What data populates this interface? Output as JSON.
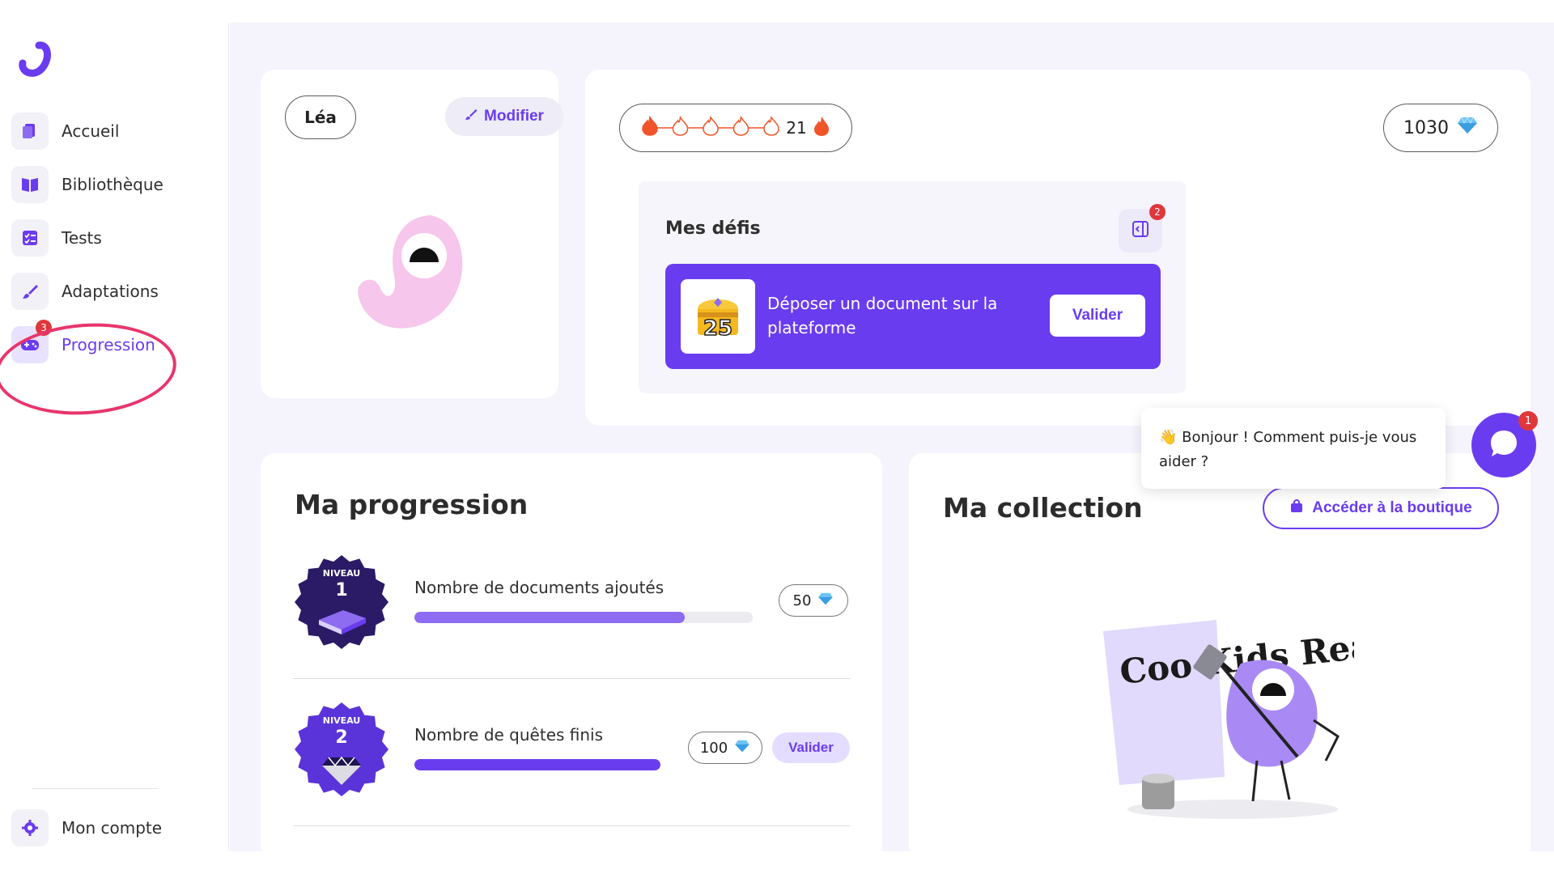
{
  "colors": {
    "accent": "#6a3cf0",
    "badge_red": "#e0373c",
    "highlight": "#e8356c",
    "background": "#f5f4fd"
  },
  "sidebar": {
    "items": [
      {
        "label": "Accueil",
        "icon": "documents-icon"
      },
      {
        "label": "Bibliothèque",
        "icon": "book-icon"
      },
      {
        "label": "Tests",
        "icon": "checklist-icon"
      },
      {
        "label": "Adaptations",
        "icon": "brush-icon"
      },
      {
        "label": "Progression",
        "icon": "gamepad-icon",
        "badge": "3",
        "active": true
      }
    ],
    "account": {
      "label": "Mon compte",
      "icon": "gear-icon"
    }
  },
  "profile": {
    "name": "Léa",
    "edit_label": "Modifier"
  },
  "stats": {
    "streak_count": "21",
    "flames_total": 5,
    "flames_filled": 1,
    "gems": "1030"
  },
  "defis": {
    "title": "Mes défis",
    "toggle_badge": "2",
    "challenge": {
      "reward": "25",
      "text": "Déposer un document sur la plateforme",
      "button": "Valider"
    }
  },
  "progression": {
    "title": "Ma progression",
    "rows": [
      {
        "level_word": "NIVEAU",
        "level": "1",
        "label": "Nombre de documents ajoutés",
        "progress": 0.8,
        "reward": "50",
        "badge_color": "#2b1a66"
      },
      {
        "level_word": "NIVEAU",
        "level": "2",
        "label": "Nombre de quêtes finis",
        "progress": 1.0,
        "reward": "100",
        "valider": "Valider",
        "badge_color": "#5a34d9"
      }
    ]
  },
  "collection": {
    "title": "Ma collection",
    "shop_label": "Accéder à la boutique",
    "illustration_text": "Coo Kids Read"
  },
  "chat": {
    "message": "👋 Bonjour ! Comment puis-je vous aider ?",
    "badge": "1"
  }
}
